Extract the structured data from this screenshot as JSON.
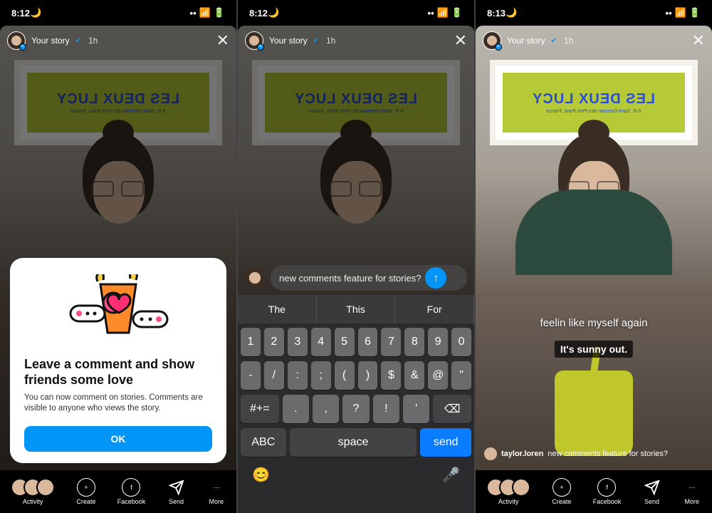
{
  "status": {
    "time_a": "8:12",
    "time_b": "8:12",
    "time_c": "8:13"
  },
  "story_header": {
    "title": "Your story",
    "age": "1h"
  },
  "poster": {
    "title": "LES DEUX LUCY",
    "sub": "6 R. Saint-Germain des Prés   Paris, France"
  },
  "modal": {
    "heading": "Leave a comment and show friends some love",
    "body": "You can now comment on stories. Comments are visible to anyone who views the story.",
    "ok": "OK"
  },
  "nav": {
    "activity": "Activity",
    "create": "Create",
    "facebook": "Facebook",
    "send": "Send",
    "more": "More"
  },
  "comment_input": "new comments feature for stories?",
  "suggestions": [
    "The",
    "This",
    "For"
  ],
  "keyboard": {
    "row1": [
      "1",
      "2",
      "3",
      "4",
      "5",
      "6",
      "7",
      "8",
      "9",
      "0"
    ],
    "row2": [
      "-",
      "/",
      ":",
      ";",
      "(",
      ")",
      "$",
      "&",
      "@",
      "\""
    ],
    "row3_shift": "#+=",
    "row3": [
      ".",
      ",",
      "?",
      "!",
      "'"
    ],
    "row3_del": "⌫",
    "abc": "ABC",
    "space": "space",
    "send": "send"
  },
  "captions": {
    "line1": "feelin like myself again",
    "line2": "It's sunny out."
  },
  "posted_comment": {
    "user": "taylor.loren",
    "text": "new comments feature for stories?"
  }
}
